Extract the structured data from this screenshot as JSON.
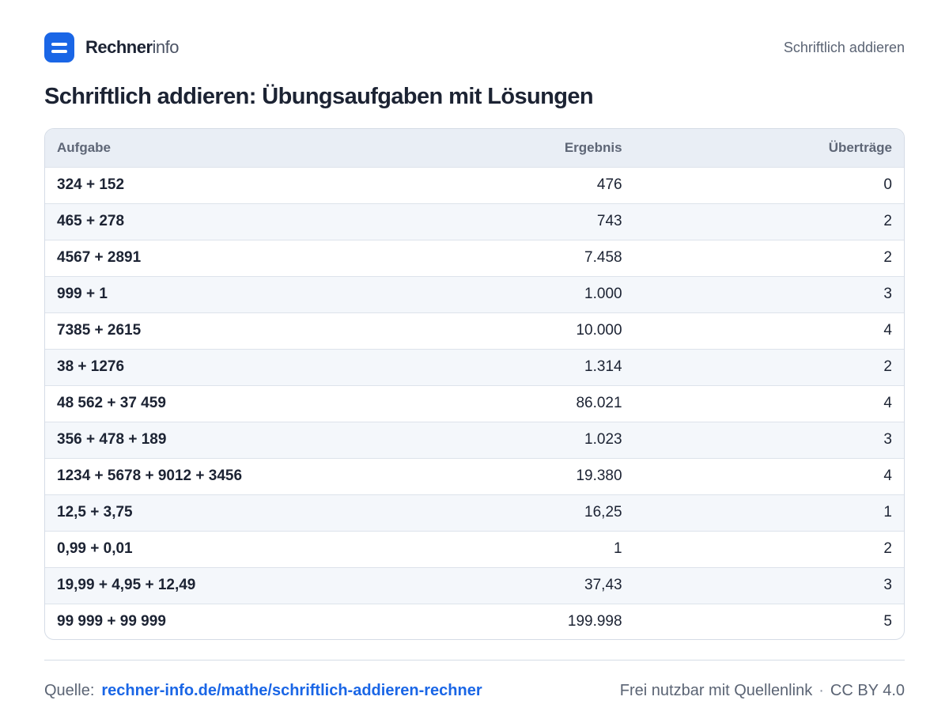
{
  "header": {
    "brand_strong": "Rechner",
    "brand_light": "info",
    "nav_link": "Schriftlich addieren"
  },
  "title": "Schriftlich addieren: Übungsaufgaben mit Lösungen",
  "table": {
    "columns": [
      "Aufgabe",
      "Ergebnis",
      "Überträge"
    ],
    "rows": [
      [
        "324 + 152",
        "476",
        "0"
      ],
      [
        "465 + 278",
        "743",
        "2"
      ],
      [
        "4567 + 2891",
        "7.458",
        "2"
      ],
      [
        "999 + 1",
        "1.000",
        "3"
      ],
      [
        "7385 + 2615",
        "10.000",
        "4"
      ],
      [
        "38 + 1276",
        "1.314",
        "2"
      ],
      [
        "48 562 + 37 459",
        "86.021",
        "4"
      ],
      [
        "356 + 478 + 189",
        "1.023",
        "3"
      ],
      [
        "1234 + 5678 + 9012 + 3456",
        "19.380",
        "4"
      ],
      [
        "12,5 + 3,75",
        "16,25",
        "1"
      ],
      [
        "0,99 + 0,01",
        "1",
        "2"
      ],
      [
        "19,99 + 4,95 + 12,49",
        "37,43",
        "3"
      ],
      [
        "99 999 + 99 999",
        "199.998",
        "5"
      ]
    ]
  },
  "footer": {
    "source_label": "Quelle:",
    "source_link": "rechner-info.de/mathe/schriftlich-addieren-rechner",
    "license_text": "Frei nutzbar mit Quellenlink",
    "separator": "·",
    "license_name": "CC BY 4.0"
  },
  "colors": {
    "accent": "#1a66e6",
    "text": "#1c2333",
    "muted": "#5b6474",
    "header_bg": "#e9eef5",
    "stripe_bg": "#f4f7fb"
  }
}
